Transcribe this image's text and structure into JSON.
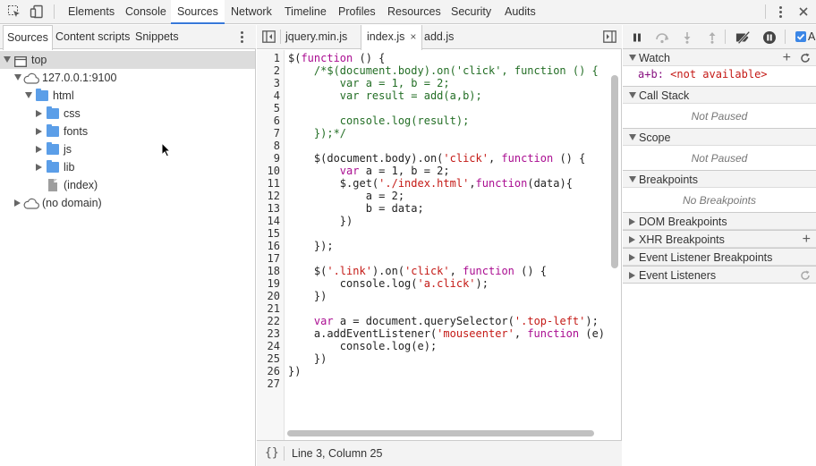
{
  "main_tabs": [
    "Elements",
    "Console",
    "Sources",
    "Network",
    "Timeline",
    "Profiles",
    "Resources",
    "Security",
    "Audits"
  ],
  "active_main_tab": "Sources",
  "left_panel": {
    "tabs": [
      "Sources",
      "Content scripts",
      "Snippets"
    ],
    "tree": {
      "top": "top",
      "host": "127.0.0.1:9100",
      "html": "html",
      "css": "css",
      "fonts": "fonts",
      "js": "js",
      "lib": "lib",
      "index": "(index)",
      "no_domain": "(no domain)"
    }
  },
  "editor": {
    "files": [
      "jquery.min.js",
      "index.js",
      "add.js"
    ],
    "active_file": "index.js",
    "close_glyph": "×",
    "line_numbers": [
      "1",
      "2",
      "3",
      "4",
      "5",
      "6",
      "7",
      "8",
      "9",
      "10",
      "11",
      "12",
      "13",
      "14",
      "15",
      "16",
      "17",
      "18",
      "19",
      "20",
      "21",
      "22",
      "23",
      "24",
      "25",
      "26",
      "27"
    ],
    "status": "Line 3, Column 25",
    "pretty_print": "{}"
  },
  "debugger": {
    "async_label": "A",
    "watch": {
      "title": "Watch",
      "expr": "a+b",
      "value": "<not available>"
    },
    "call_stack": {
      "title": "Call Stack",
      "msg": "Not Paused"
    },
    "scope": {
      "title": "Scope",
      "msg": "Not Paused"
    },
    "breakpoints": {
      "title": "Breakpoints",
      "msg": "No Breakpoints"
    },
    "dom_breakpoints": "DOM Breakpoints",
    "xhr_breakpoints": "XHR Breakpoints",
    "event_listener_breakpoints": "Event Listener Breakpoints",
    "event_listeners": "Event Listeners"
  },
  "colors": {
    "accent": "#3879d9",
    "folder": "#5b9ee8",
    "keyword": "#aa0d91",
    "string": "#c41a16",
    "comment": "#236e25",
    "watch_error": "#c41a16"
  },
  "icons": [
    "inspect-icon",
    "device-icon",
    "kebab-icon",
    "sidebar-toggle-icon",
    "pause-icon",
    "step-over-icon",
    "step-into-icon",
    "step-out-icon",
    "deactivate-breakpoints-icon",
    "pause-on-exceptions-icon",
    "add-icon",
    "refresh-icon",
    "cloud-icon",
    "folder-icon",
    "file-icon"
  ]
}
